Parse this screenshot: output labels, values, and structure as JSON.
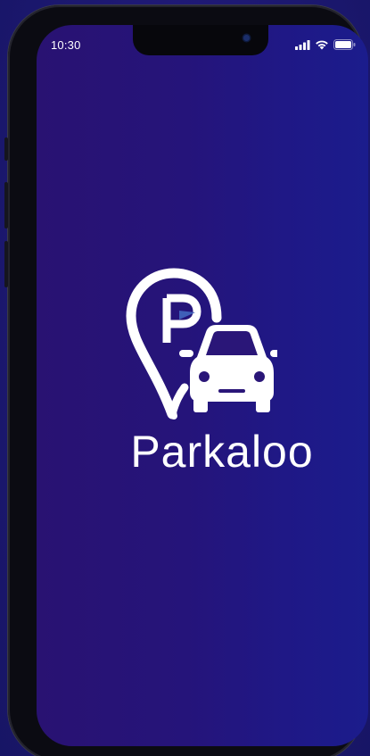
{
  "status_bar": {
    "time": "10:30",
    "signal_icon": "signal-icon",
    "wifi_icon": "wifi-icon",
    "battery_icon": "battery-icon"
  },
  "splash": {
    "app_name": "Parkaloo",
    "logo_icon": "parking-pin-car-logo"
  },
  "colors": {
    "background_start": "#291272",
    "background_end": "#1b1c8c",
    "logo_accent": "#3f5fb8",
    "text": "#ffffff"
  }
}
